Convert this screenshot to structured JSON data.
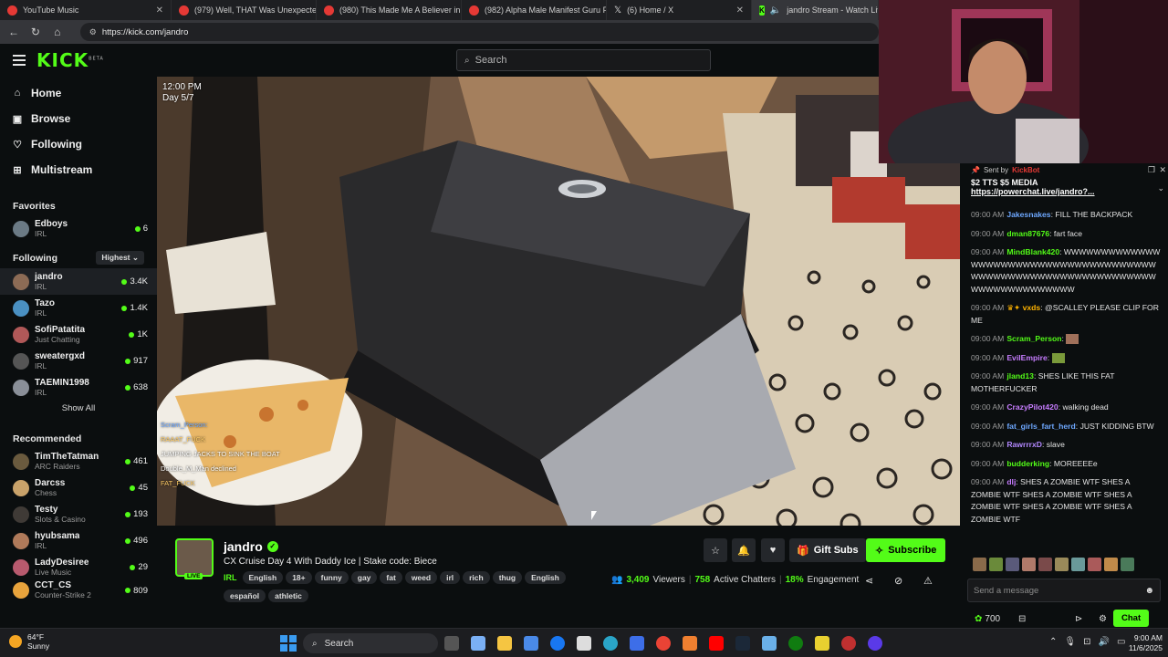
{
  "browser": {
    "tabs": [
      {
        "title": "YouTube Music",
        "icon": "youtube-music-icon",
        "active": false
      },
      {
        "title": "(979) Well, THAT Was Unexpected",
        "icon": "youtube-icon",
        "active": false
      },
      {
        "title": "(980) This Made Me A Believer in",
        "icon": "youtube-icon",
        "active": false
      },
      {
        "title": "(982) Alpha Male Manifest Guru F",
        "icon": "youtube-icon",
        "active": false
      },
      {
        "title": "(6) Home / X",
        "icon": "x-icon",
        "active": false
      },
      {
        "title": "jandro Stream - Watch Live",
        "icon": "kick-icon",
        "active": true
      }
    ],
    "url": "https://kick.com/jandro"
  },
  "header": {
    "logo": "KICK",
    "logo_badge": "BETA",
    "search_placeholder": "Search"
  },
  "sidebar": {
    "nav": [
      {
        "label": "Home",
        "icon": "home-icon"
      },
      {
        "label": "Browse",
        "icon": "browse-icon"
      },
      {
        "label": "Following",
        "icon": "heart-icon"
      },
      {
        "label": "Multistream",
        "icon": "grid-icon"
      }
    ],
    "favorites_title": "Favorites",
    "favorites": [
      {
        "name": "Edboys",
        "category": "IRL",
        "viewers": "6"
      }
    ],
    "following_title": "Following",
    "sort_label": "Highest",
    "following": [
      {
        "name": "jandro",
        "category": "IRL",
        "viewers": "3.4K",
        "selected": true
      },
      {
        "name": "Tazo",
        "category": "IRL",
        "viewers": "1.4K"
      },
      {
        "name": "SofiPatatita",
        "category": "Just Chatting",
        "viewers": "1K"
      },
      {
        "name": "sweatergxd",
        "category": "IRL",
        "viewers": "917"
      },
      {
        "name": "TAEMIN1998",
        "category": "IRL",
        "viewers": "638"
      }
    ],
    "show_all": "Show All",
    "recommended_title": "Recommended",
    "recommended": [
      {
        "name": "TimTheTatman",
        "category": "ARC Raiders",
        "viewers": "461"
      },
      {
        "name": "Darcss",
        "category": "Chess",
        "viewers": "45"
      },
      {
        "name": "Testy",
        "category": "Slots & Casino",
        "viewers": "193"
      },
      {
        "name": "hyubsama",
        "category": "IRL",
        "viewers": "496"
      },
      {
        "name": "LadyDesiree",
        "category": "Live Music",
        "viewers": "29"
      },
      {
        "name": "CCT_CS",
        "category": "Counter-Strike 2",
        "viewers": "809"
      }
    ]
  },
  "video": {
    "time": "12:00 PM",
    "day": "Day 5/7",
    "overlay_chat": [
      "Scram_Person:",
      "RAAAT_FUCK",
      "JUMPING JACKS TO SINK THE BOAT",
      "Double_M_Man declined",
      "FAT_FUCK"
    ]
  },
  "chat": {
    "pinned": {
      "sent_by_label": "Sent by",
      "sender": "KickBot",
      "text": "$2 TTS $5 MEDIA",
      "link": "https://powerchat.live/jandro?..."
    },
    "messages": [
      {
        "time": "09:00 AM",
        "user": "Jakesnakes",
        "color": "#6ea8ff",
        "text": "FILL THE BACKPACK"
      },
      {
        "time": "09:00 AM",
        "user": "dman87676",
        "color": "#53fc18",
        "text": "fart face"
      },
      {
        "time": "09:00 AM",
        "user": "MindBlank420",
        "color": "#53fc18",
        "text": "WWWWWWWWWWWWWWWWWWWWWWWWWWWWWWWWWWWWWWWWWWWWWWWWWWWWWWWWWWWWWWWWWWWWWWWWWWWWW"
      },
      {
        "time": "09:00 AM",
        "user": "vxds",
        "color": "#ffb300",
        "text": "@SCALLEY PLEASE CLIP FOR ME"
      },
      {
        "time": "09:00 AM",
        "user": "Scram_Person",
        "color": "#53fc18",
        "text": ""
      },
      {
        "time": "09:00 AM",
        "user": "EvilEmpire",
        "color": "#c77dff",
        "text": ""
      },
      {
        "time": "09:00 AM",
        "user": "jland13",
        "color": "#53fc18",
        "text": "SHES LIKE THIS FAT MOTHERFUCKER"
      },
      {
        "time": "09:00 AM",
        "user": "CrazyPilot420",
        "color": "#c77dff",
        "text": "walking dead"
      },
      {
        "time": "09:00 AM",
        "user": "fat_girls_fart_herd",
        "color": "#6ea8ff",
        "text": "JUST KIDDING BTW"
      },
      {
        "time": "09:00 AM",
        "user": "RawrrrxD",
        "color": "#b388ff",
        "text": "slave"
      },
      {
        "time": "09:00 AM",
        "user": "budderking",
        "color": "#53fc18",
        "text": "MOREEEEe"
      },
      {
        "time": "09:00 AM",
        "user": "dlj",
        "color": "#c77dff",
        "text": "SHES A ZOMBIE WTF SHES A ZOMBIE WTF SHES A ZOMBIE WTF SHES A ZOMBIE WTF SHES A ZOMBIE WTF SHES A ZOMBIE WTF"
      }
    ],
    "input_placeholder": "Send a message",
    "points": "700",
    "chat_button": "Chat"
  },
  "stream": {
    "name": "jandro",
    "live_badge": "LIVE",
    "title": "CX Cruise Day 4 With Daddy Ice | Stake code: Biece",
    "category": "IRL",
    "tags": [
      "English",
      "18+",
      "funny",
      "gay",
      "fat",
      "weed",
      "irl",
      "rich",
      "thug",
      "English",
      "español",
      "athletic"
    ],
    "gift_subs": "Gift Subs",
    "subscribe": "Subscribe",
    "viewers": "3,409",
    "viewers_label": "Viewers",
    "chatters": "758",
    "chatters_label": "Active Chatters",
    "engagement": "18%",
    "engagement_label": "Engagement"
  },
  "taskbar": {
    "weather_temp": "64°F",
    "weather_desc": "Sunny",
    "search_label": "Search",
    "time": "9:00 AM",
    "date": "11/6/2025"
  },
  "colors": {
    "kick_green": "#53fc18",
    "bg": "#0b0e0f",
    "panel": "#24272b"
  }
}
